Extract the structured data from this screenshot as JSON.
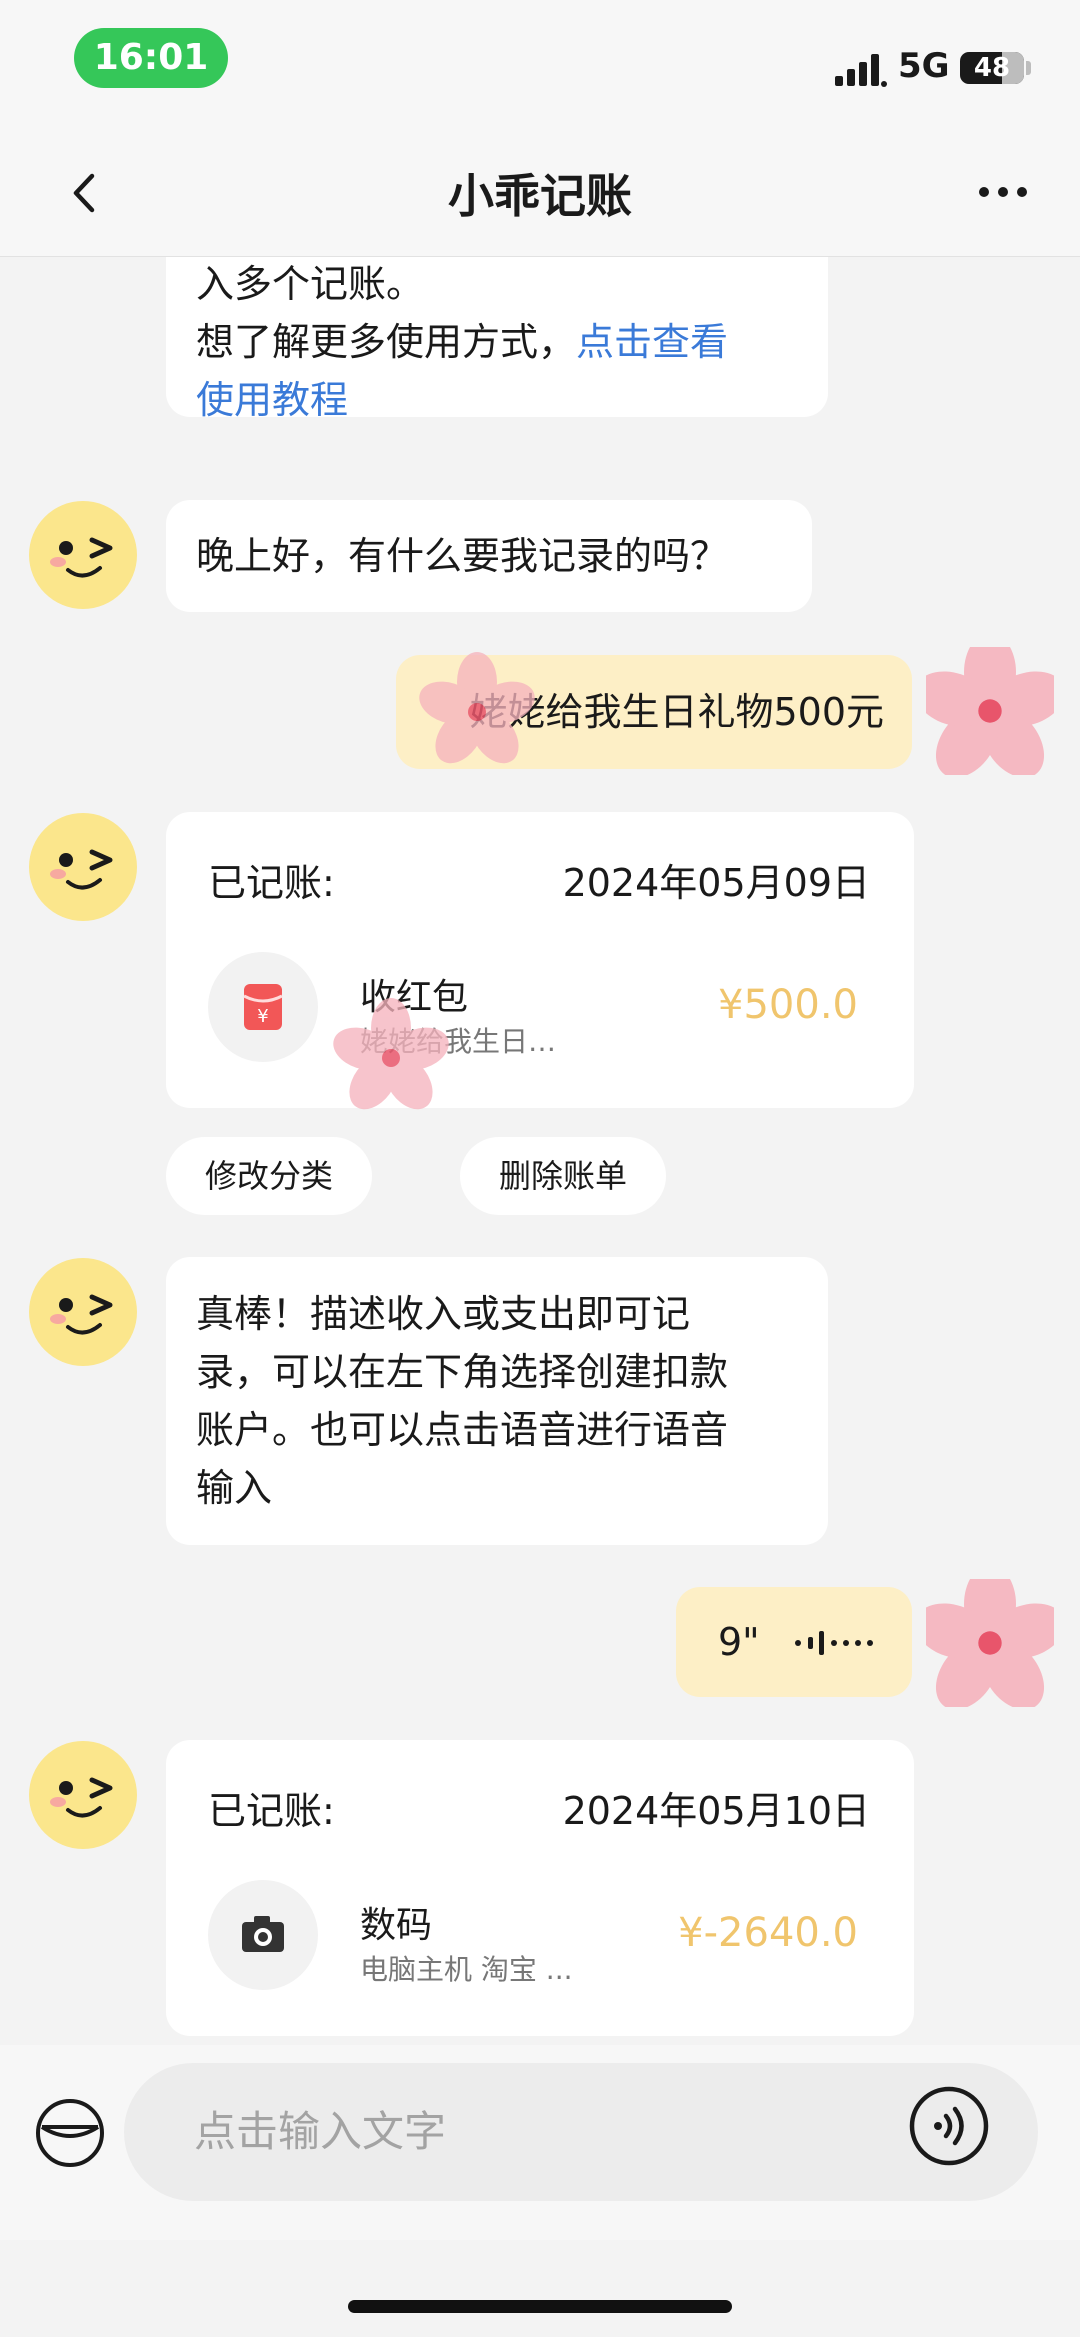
{
  "status_bar": {
    "time": "16:01",
    "network": "5G",
    "battery": "48"
  },
  "header": {
    "title": "小乖记账"
  },
  "messages": {
    "intro": {
      "line1": "入多个记账。",
      "line2_prefix": "想了解更多使用方式，",
      "line2_link": "点击查看",
      "line3_link": "使用教程"
    },
    "greeting": "晚上好，有什么要我记录的吗？",
    "user_text": "姥姥给我生日礼物500元",
    "record1": {
      "label": "已记账:",
      "date": "2024年05月09日",
      "category": "收红包",
      "note": "姥姥给我生日…",
      "amount": "¥500.0"
    },
    "actions": {
      "edit": "修改分类",
      "delete": "删除账单"
    },
    "tip": {
      "line1": "真棒！描述收入或支出即可记",
      "line2": "录，可以在左下角选择创建扣款",
      "line3": "账户。也可以点击语音进行语音",
      "line4": "输入"
    },
    "voice": {
      "duration": "9\""
    },
    "record2": {
      "label": "已记账:",
      "date": "2024年05月10日",
      "category": "数码",
      "note": "电脑主机 淘宝 ...",
      "amount": "¥-2640.0"
    }
  },
  "input": {
    "placeholder": "点击输入文字"
  },
  "icons": {
    "back": "chevron-left-icon",
    "more": "more-horizontal-icon",
    "wallet": "wallet-icon",
    "voice": "voice-icon",
    "red_packet": "red-packet-icon",
    "camera": "camera-icon"
  },
  "colors": {
    "accent_green": "#35c759",
    "link_blue": "#3a7ad8",
    "amount_gold": "#f0c56d",
    "user_bubble": "#fdefc6"
  }
}
